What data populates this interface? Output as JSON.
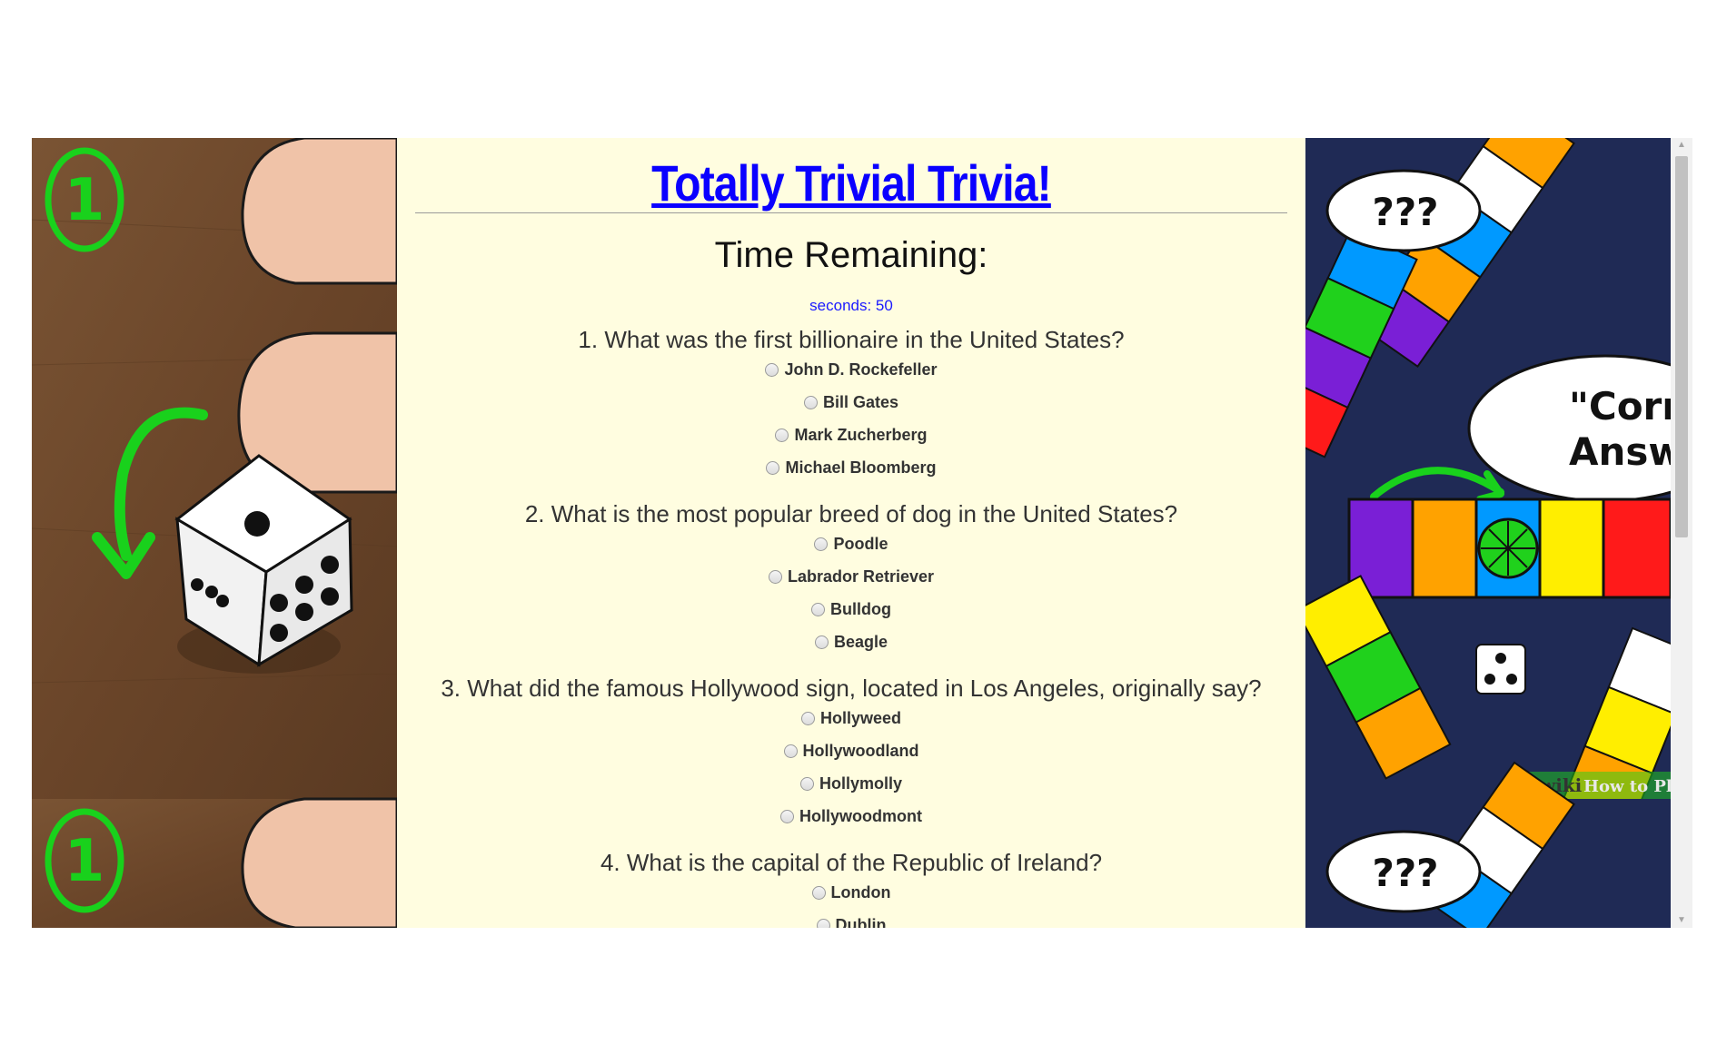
{
  "page": {
    "title": "Totally Trivial Trivia!",
    "timer_heading": "Time Remaining:",
    "timer_text": "seconds: 50"
  },
  "background": {
    "left_tile_digit": "1",
    "right_tile_bubble": "???",
    "right_tile_callout_line1": "\"Corr",
    "right_tile_callout_line2": "Answ",
    "right_tile_watermark_wiki": "wiki",
    "right_tile_watermark_rest": "How to Pla"
  },
  "questions": [
    {
      "text": "1. What was the first billionaire in the United States?",
      "options": [
        "John D. Rockefeller",
        "Bill Gates",
        "Mark Zucherberg",
        "Michael Bloomberg"
      ]
    },
    {
      "text": "2. What is the most popular breed of dog in the United States?",
      "options": [
        "Poodle",
        "Labrador Retriever",
        "Bulldog",
        "Beagle"
      ]
    },
    {
      "text": "3. What did the famous Hollywood sign, located in Los Angeles, originally say?",
      "options": [
        "Hollyweed",
        "Hollywoodland",
        "Hollymolly",
        "Hollywoodmont"
      ]
    },
    {
      "text": "4. What is the capital of the Republic of Ireland?",
      "options": [
        "London",
        "Dublin"
      ]
    }
  ],
  "colors": {
    "title": "#0a00ff",
    "timer": "#1a1aff",
    "page_bg": "#fffde0",
    "left_wood": "#6e4a2e",
    "green_marker": "#19d11c",
    "board_navy": "#1f2a55"
  }
}
